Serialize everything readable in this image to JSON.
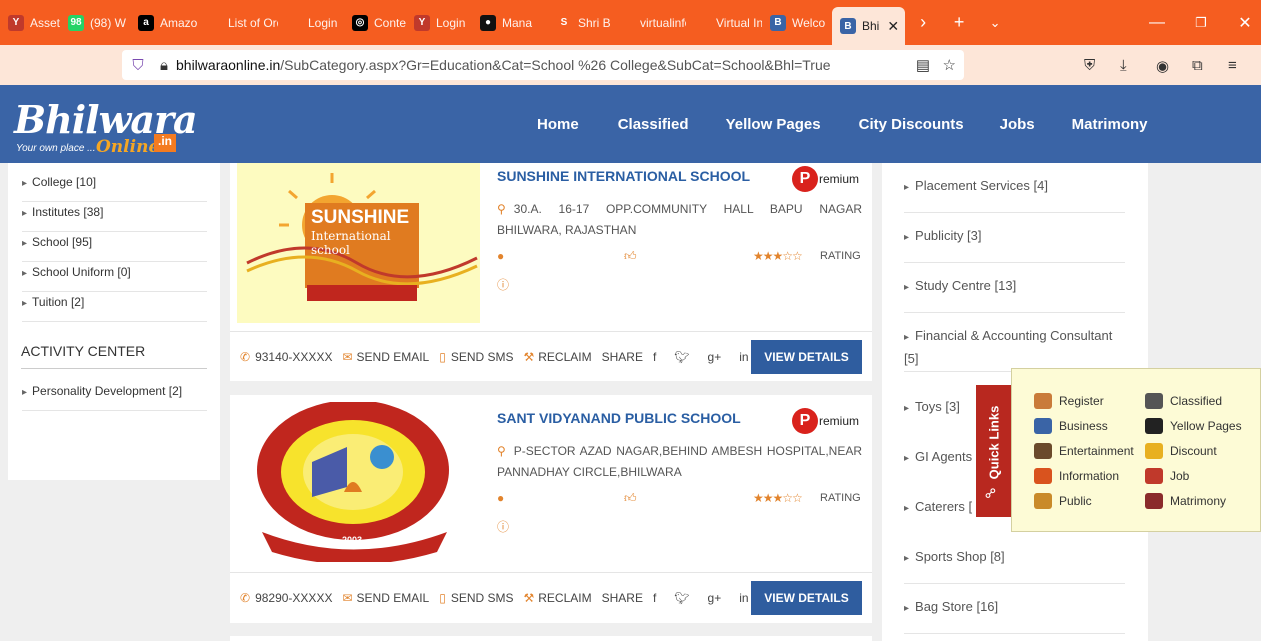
{
  "browser": {
    "tabs": [
      {
        "title": "Assets",
        "fav_color": "#c0392b",
        "fav_text": "Y"
      },
      {
        "title": "(98) W",
        "fav_color": "#25d366",
        "fav_text": "98"
      },
      {
        "title": "Amazon",
        "fav_color": "#000000",
        "fav_text": "a"
      },
      {
        "title": "List of Ord",
        "fav_color": "#f55d20",
        "fav_text": ""
      },
      {
        "title": "Login",
        "fav_color": "#f55d20",
        "fav_text": ""
      },
      {
        "title": "Conte",
        "fav_color": "#000000",
        "fav_text": "◎"
      },
      {
        "title": "Login",
        "fav_color": "#c0392b",
        "fav_text": "Y"
      },
      {
        "title": "Mana",
        "fav_color": "#111111",
        "fav_text": "●"
      },
      {
        "title": "Shri B",
        "fav_color": "#f55d20",
        "fav_text": "S"
      },
      {
        "title": "virtualinfo",
        "fav_color": "#f55d20",
        "fav_text": ""
      },
      {
        "title": "Virtual Info",
        "fav_color": "#f55d20",
        "fav_text": ""
      },
      {
        "title": "Welco",
        "fav_color": "#3a64a6",
        "fav_text": "B"
      }
    ],
    "active_tab": {
      "title": "Bhi",
      "fav_text": "B"
    },
    "url_domain": "bhilwaraonline.in",
    "url_path": "/SubCategory.aspx?Gr=Education&Cat=School %26 College&SubCat=School&Bhl=True"
  },
  "site": {
    "logo_text": "Bhilwara",
    "logo_online": "Online",
    "logo_in": ".in",
    "logo_tagline": "Your own place ...",
    "nav": [
      "Home",
      "Classified",
      "Yellow Pages",
      "City Discounts",
      "Jobs",
      "Matrimony"
    ]
  },
  "left_sidebar": {
    "categories": [
      "College [10]",
      "Institutes [38]",
      "School [95]",
      "School Uniform [0]",
      "Tuition [2]"
    ],
    "activity_heading": "ACTIVITY CENTER",
    "activity_items": [
      "Personality Development [2]"
    ]
  },
  "listings": [
    {
      "name": "SUNSHINE INTERNATIONAL SCHOOL",
      "premium_p": "P",
      "premium_text": "remium",
      "address": "30.A. 16-17 OPP.COMMUNITY HALL BAPU NAGAR BHILWARA, RAJASTHAN",
      "rating_label": "RATING",
      "stars": "★★★☆☆",
      "phone": "93140-XXXXX",
      "send_email": "SEND EMAIL",
      "send_sms": "SEND SMS",
      "reclaim": "RECLAIM",
      "share": "SHARE",
      "view": "VIEW DETAILS",
      "logo_title": "SUNSHINE",
      "logo_sub": "International school"
    },
    {
      "name": "SANT VIDYANAND PUBLIC SCHOOL",
      "premium_p": "P",
      "premium_text": "remium",
      "address": "P-SECTOR AZAD NAGAR,BEHIND AMBESH HOSPITAL,NEAR PANNADHAY CIRCLE,BHILWARA",
      "rating_label": "RATING",
      "stars": "★★★☆☆",
      "phone": "98290-XXXXX",
      "send_email": "SEND EMAIL",
      "send_sms": "SEND SMS",
      "reclaim": "RECLAIM",
      "share": "SHARE",
      "view": "VIEW DETAILS",
      "logo_year": "2003"
    }
  ],
  "right_sidebar": {
    "items": [
      "Placement Services [4]",
      "Publicity [3]",
      "Study Centre [13]",
      "Financial & Accounting Consultant [5]",
      "Toys [3]",
      "GI Agents",
      "Caterers [",
      "Sports Shop [8]",
      "Bag Store [16]"
    ]
  },
  "quick_links": {
    "tab_label": "Quick Links",
    "items": [
      {
        "label": "Register",
        "color": "#c97b3a"
      },
      {
        "label": "Classified",
        "color": "#555555"
      },
      {
        "label": "Business",
        "color": "#3a64a6"
      },
      {
        "label": "Yellow Pages",
        "color": "#222222"
      },
      {
        "label": "Entertainment",
        "color": "#6b4a2b"
      },
      {
        "label": "Discount",
        "color": "#e8b020"
      },
      {
        "label": "Information",
        "color": "#d9531e"
      },
      {
        "label": "Job",
        "color": "#c0392b"
      },
      {
        "label": "Public",
        "color": "#c98a2a"
      },
      {
        "label": "Matrimony",
        "color": "#8a2b2b"
      }
    ]
  }
}
